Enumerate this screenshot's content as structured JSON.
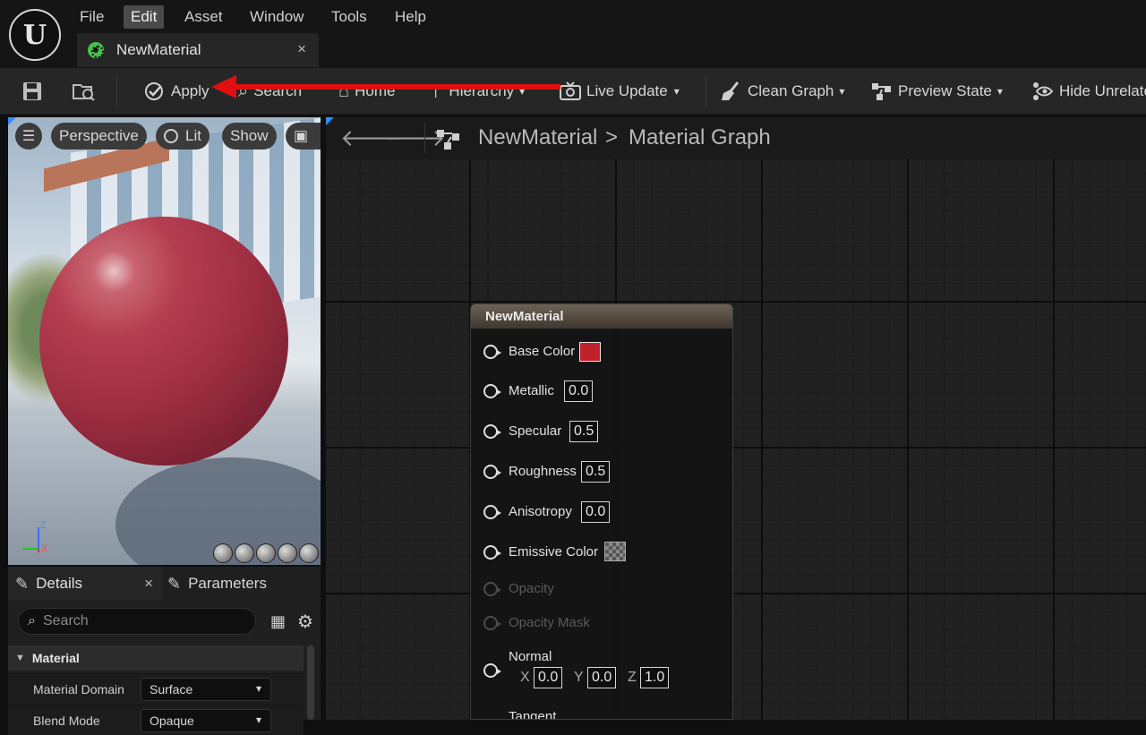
{
  "menu": {
    "items": [
      "File",
      "Edit",
      "Asset",
      "Window",
      "Tools",
      "Help"
    ],
    "active": "Edit"
  },
  "tab": {
    "title": "NewMaterial",
    "close": "×"
  },
  "toolbar": {
    "apply": "Apply",
    "search": "Search",
    "home": "Home",
    "hierarchy": "Hierarchy",
    "live_update": "Live Update",
    "clean_graph": "Clean Graph",
    "preview_state": "Preview State",
    "hide_unrelated": "Hide Unrelate"
  },
  "viewport": {
    "perspective": "Perspective",
    "lit": "Lit",
    "show": "Show",
    "axis_z": "Z",
    "axis_x": "X"
  },
  "details": {
    "tab_details": "Details",
    "tab_params": "Parameters",
    "close": "×",
    "search_placeholder": "Search",
    "section": "Material",
    "rows": [
      {
        "name": "Material Domain",
        "value": "Surface"
      },
      {
        "name": "Blend Mode",
        "value": "Opaque"
      }
    ]
  },
  "graph": {
    "breadcrumb_root": "NewMaterial",
    "breadcrumb_sep": ">",
    "breadcrumb_leaf": "Material Graph"
  },
  "node": {
    "title": "NewMaterial",
    "pins": {
      "base_color": "Base Color",
      "metallic": "Metallic",
      "metallic_value": "0.0",
      "specular": "Specular",
      "specular_value": "0.5",
      "roughness": "Roughness",
      "roughness_value": "0.5",
      "anisotropy": "Anisotropy",
      "anisotropy_value": "0.0",
      "emissive": "Emissive Color",
      "opacity": "Opacity",
      "opacity_mask": "Opacity Mask",
      "normal": "Normal",
      "normal_x_label": "X",
      "normal_x": "0.0",
      "normal_y_label": "Y",
      "normal_y": "0.0",
      "normal_z_label": "Z",
      "normal_z": "1.0",
      "tangent": "Tangent"
    },
    "base_color_hex": "#c0202a"
  },
  "colors": {
    "annotation_arrow": "#e01010",
    "accent": "#2f8dff"
  }
}
